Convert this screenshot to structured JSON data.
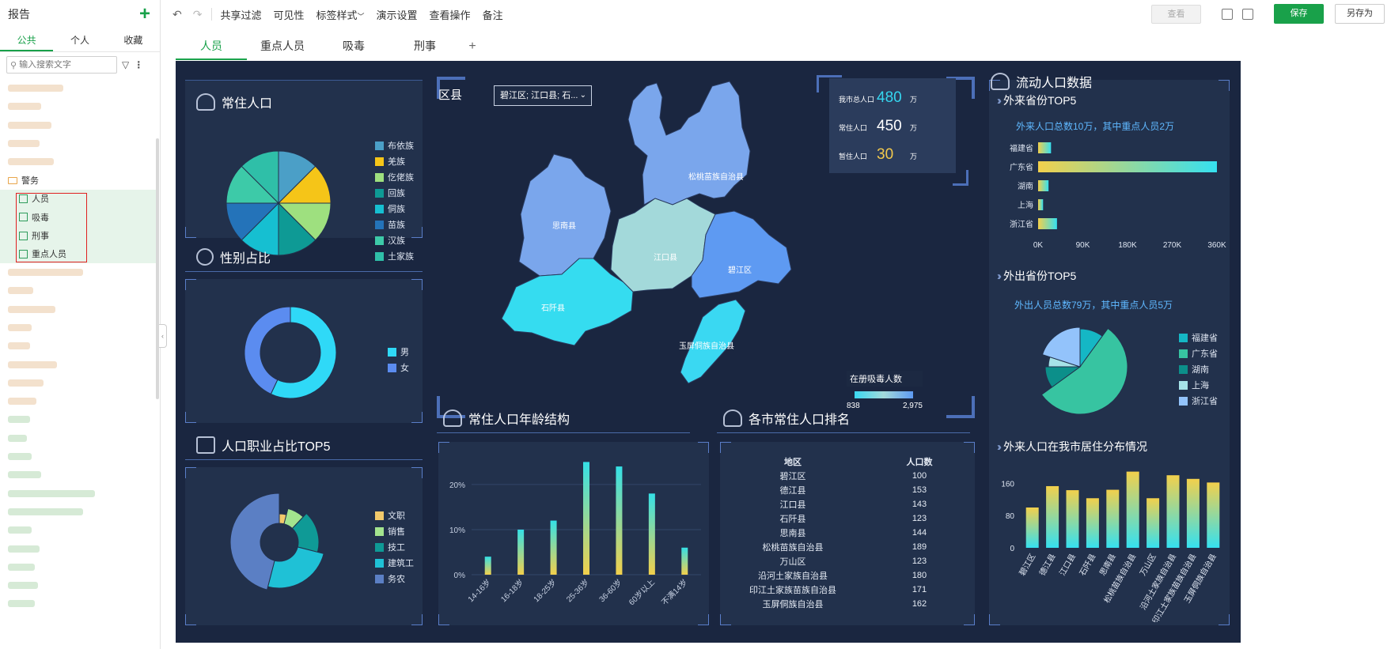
{
  "sidebar": {
    "title": "报告",
    "tabs": [
      "公共",
      "个人",
      "收藏"
    ],
    "search_placeholder": "输入搜索文字",
    "folder_police": "警务",
    "reports": [
      "人员",
      "吸毒",
      "刑事",
      "重点人员"
    ]
  },
  "toolbar": {
    "menus": [
      "共享过滤",
      "可见性",
      "标签样式",
      "演示设置",
      "查看操作",
      "备注"
    ],
    "view_label": "查看",
    "save_label": "保存",
    "save_as_label": "另存为"
  },
  "report_tabs": [
    "人员",
    "重点人员",
    "吸毒",
    "刑事"
  ],
  "dashboard": {
    "resident_title": "常住人口",
    "gender_title": "性别占比",
    "occupation_title": "人口职业占比TOP5",
    "county_label": "区县",
    "county_select": "碧江区; 江口县; 石...",
    "age_title": "常住人口年龄结构",
    "ranking_title": "各市常住人口排名",
    "flow_title": "流动人口数据",
    "in_top5_title": "外来省份TOP5",
    "in_note": "外来人口总数10万，其中重点人员2万",
    "out_top5_title": "外出省份TOP5",
    "out_note": "外出人员总数79万，其中重点人员5万",
    "dist_title": "外来人口在我市居住分布情况",
    "stats": [
      {
        "label": "我市总人口",
        "value": "480",
        "unit": "万",
        "color": "#35d6f0"
      },
      {
        "label": "常住人口",
        "value": "450",
        "unit": "万",
        "color": "#ffffff"
      },
      {
        "label": "暂住人口",
        "value": "30",
        "unit": "万",
        "color": "#f2c94c"
      }
    ],
    "map_legend_title": "在册吸毒人数",
    "map_legend_min": "838",
    "map_legend_max": "2,975",
    "map_regions": [
      "思南县",
      "石阡县",
      "江口县",
      "碧江区",
      "松桃苗族自治县",
      "玉屏侗族自治县"
    ]
  },
  "chart_data": [
    {
      "type": "pie",
      "name": "ethnic",
      "labels": [
        "布依族",
        "羌族",
        "仡佬族",
        "回族",
        "侗族",
        "苗族",
        "汉族",
        "土家族"
      ],
      "values": [
        12.5,
        12.5,
        12.5,
        12.5,
        12.5,
        12.5,
        12.5,
        12.5
      ],
      "colors": [
        "#4b9fc7",
        "#f5c518",
        "#9ee07f",
        "#0e9a95",
        "#16bfd1",
        "#2473b9",
        "#3dcaa8",
        "#2fbfa8"
      ]
    },
    {
      "type": "pie",
      "name": "gender",
      "labels": [
        "男",
        "女"
      ],
      "values": [
        57,
        43
      ],
      "colors": [
        "#2fd9f7",
        "#5b8cf0"
      ]
    },
    {
      "type": "pie",
      "name": "occupation",
      "labels": [
        "文职",
        "销售",
        "技工",
        "建筑工",
        "务农"
      ],
      "values": [
        4,
        8,
        17,
        25,
        46
      ],
      "colors": [
        "#f2c96b",
        "#a3e48e",
        "#0f9a96",
        "#1fc1d6",
        "#5b7fc4"
      ]
    },
    {
      "type": "bar",
      "name": "age",
      "categories": [
        "14-16岁",
        "16-18岁",
        "18-25岁",
        "25-36岁",
        "36-60岁",
        "60岁以上",
        "不满14岁"
      ],
      "values": [
        4,
        10,
        12,
        25,
        24,
        18,
        6
      ],
      "yticks": [
        "0%",
        "10%",
        "20%"
      ],
      "ylim": [
        0,
        27
      ]
    },
    {
      "type": "table",
      "name": "ranking",
      "columns": [
        "地区",
        "人口数"
      ],
      "rows": [
        [
          "碧江区",
          "100"
        ],
        [
          "德江县",
          "153"
        ],
        [
          "江口县",
          "143"
        ],
        [
          "石阡县",
          "123"
        ],
        [
          "思南县",
          "144"
        ],
        [
          "松桃苗族自治县",
          "189"
        ],
        [
          "万山区",
          "123"
        ],
        [
          "沿河土家族自治县",
          "180"
        ],
        [
          "印江土家族苗族自治县",
          "171"
        ],
        [
          "玉屏侗族自治县",
          "162"
        ]
      ]
    },
    {
      "type": "bar",
      "name": "in_provinces",
      "orientation": "horizontal",
      "categories": [
        "福建省",
        "广东省",
        "湖南",
        "上海",
        "浙江省"
      ],
      "values": [
        26000,
        360000,
        21000,
        10000,
        38000
      ],
      "xticks": [
        "0K",
        "90K",
        "180K",
        "270K",
        "360K"
      ],
      "xlim": [
        0,
        360000
      ]
    },
    {
      "type": "pie",
      "name": "out_provinces",
      "labels": [
        "福建省",
        "广东省",
        "湖南",
        "上海",
        "浙江省"
      ],
      "values": [
        10,
        55,
        10,
        5,
        20
      ],
      "colors": [
        "#15b7c5",
        "#37c4a1",
        "#0c8f8a",
        "#a6e3e8",
        "#93c3fb"
      ]
    },
    {
      "type": "bar",
      "name": "distribution",
      "categories": [
        "碧江区",
        "德江县",
        "江口县",
        "石阡县",
        "思南县",
        "松桃苗族自治县",
        "万山区",
        "沿河土家族自治县",
        "印江土家族苗族自治县",
        "玉屏侗族自治县"
      ],
      "values": [
        100,
        153,
        143,
        123,
        144,
        189,
        123,
        180,
        171,
        162
      ],
      "yticks": [
        "0",
        "80",
        "160"
      ],
      "ylim": [
        0,
        200
      ]
    }
  ]
}
